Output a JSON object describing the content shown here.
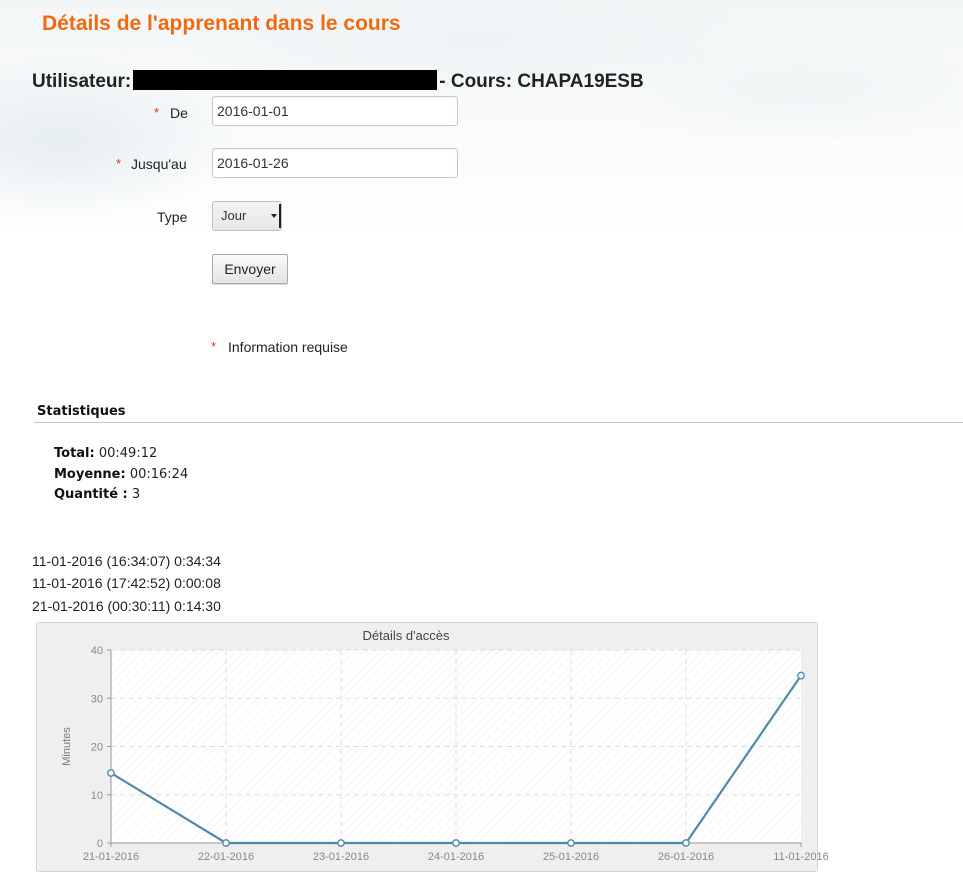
{
  "header": {
    "title": "Détails de l'apprenant dans le cours",
    "user_label": "Utilisateur:",
    "course_text": "- Cours: CHAPA19ESB"
  },
  "form": {
    "required_mark": "*",
    "from_label": "De",
    "from_value": "2016-01-01",
    "to_label": "Jusqu'au",
    "to_value": "2016-01-26",
    "type_label": "Type",
    "type_value": "Jour",
    "submit_label": "Envoyer",
    "required_note": "Information requise"
  },
  "stats": {
    "heading": "Statistiques",
    "total_label": "Total:",
    "total_value": "00:49:12",
    "average_label": "Moyenne:",
    "average_value": "00:16:24",
    "count_label": "Quantité :",
    "count_value": "3"
  },
  "entries": [
    "11-01-2016 (16:34:07) 0:34:34",
    "11-01-2016 (17:42:52) 0:00:08",
    "21-01-2016 (00:30:11) 0:14:30"
  ],
  "colors": {
    "title": "#f06a10",
    "required": "#e0301e",
    "series_line": "#4f8ba8"
  },
  "chart_data": {
    "type": "line",
    "title": "Détails d'accès",
    "ylabel": "Minutes",
    "xlabel": "",
    "categories": [
      "21-01-2016",
      "22-01-2016",
      "23-01-2016",
      "24-01-2016",
      "25-01-2016",
      "26-01-2016",
      "11-01-2016"
    ],
    "values": [
      14.5,
      0,
      0,
      0,
      0,
      0,
      34.7
    ],
    "ylim": [
      0,
      40
    ],
    "yticks": [
      0,
      10,
      20,
      30,
      40
    ],
    "grid": true,
    "legend": "none"
  }
}
